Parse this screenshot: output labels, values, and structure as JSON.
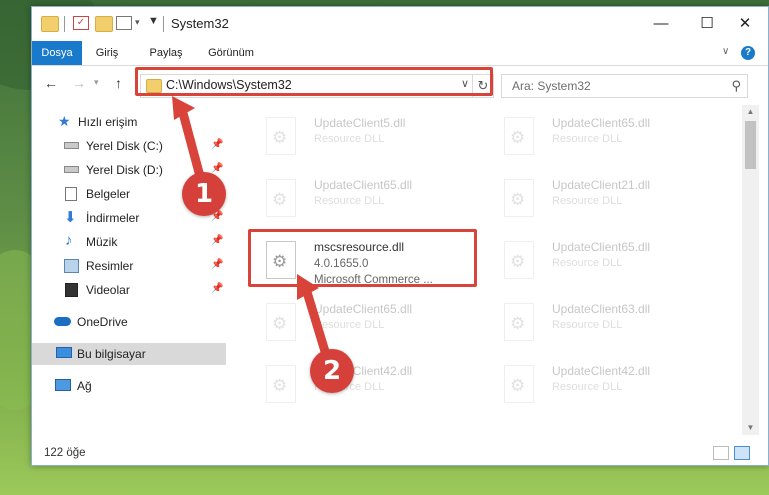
{
  "window": {
    "title": "System32"
  },
  "ribbon": {
    "tabs": [
      {
        "label": "Dosya",
        "active": true
      },
      {
        "label": "Giriş",
        "active": false
      },
      {
        "label": "Paylaş",
        "active": false
      },
      {
        "label": "Görünüm",
        "active": false
      }
    ]
  },
  "address": {
    "path": "C:\\Windows\\System32"
  },
  "search": {
    "placeholder": "Ara: System32"
  },
  "sidebar": {
    "items": [
      {
        "label": "Hızlı erişim",
        "icon": "star-icon"
      },
      {
        "label": "Yerel Disk (C:)",
        "icon": "drive-icon"
      },
      {
        "label": "Yerel Disk (D:)",
        "icon": "drive-icon"
      },
      {
        "label": "Belgeler",
        "icon": "document-icon"
      },
      {
        "label": "İndirmeler",
        "icon": "download-icon"
      },
      {
        "label": "Müzik",
        "icon": "music-icon"
      },
      {
        "label": "Resimler",
        "icon": "pictures-icon"
      },
      {
        "label": "Videolar",
        "icon": "video-icon"
      },
      {
        "label": "OneDrive",
        "icon": "cloud-icon"
      },
      {
        "label": "Bu bilgisayar",
        "icon": "computer-icon"
      },
      {
        "label": "Ağ",
        "icon": "network-icon"
      }
    ]
  },
  "files": {
    "col1": [
      {
        "name": "UpdateClient5.dll",
        "type": "Resource DLL"
      },
      {
        "name": "UpdateClient65.dll",
        "type": "Resource DLL"
      },
      {
        "name": "mscsresource.dll",
        "version": "4.0.1655.0",
        "description": "Microsoft Commerce ..."
      },
      {
        "name": "UpdateClient65.dll",
        "type": "Resource DLL"
      },
      {
        "name": "UpdateClient42.dll",
        "type": "Resource DLL"
      }
    ],
    "col2": [
      {
        "name": "UpdateClient65.dll",
        "type": "Resource DLL"
      },
      {
        "name": "UpdateClient21.dll",
        "type": "Resource DLL"
      },
      {
        "name": "UpdateClient65.dll",
        "type": "Resource DLL"
      },
      {
        "name": "UpdateClient63.dll",
        "type": "Resource DLL"
      },
      {
        "name": "UpdateClient42.dll",
        "type": "Resource DLL"
      }
    ]
  },
  "status": {
    "count": "122 öğe"
  },
  "annotations": {
    "badge1": "1",
    "badge2": "2"
  },
  "colors": {
    "accent": "#1979ca",
    "highlight": "#d9443a"
  }
}
